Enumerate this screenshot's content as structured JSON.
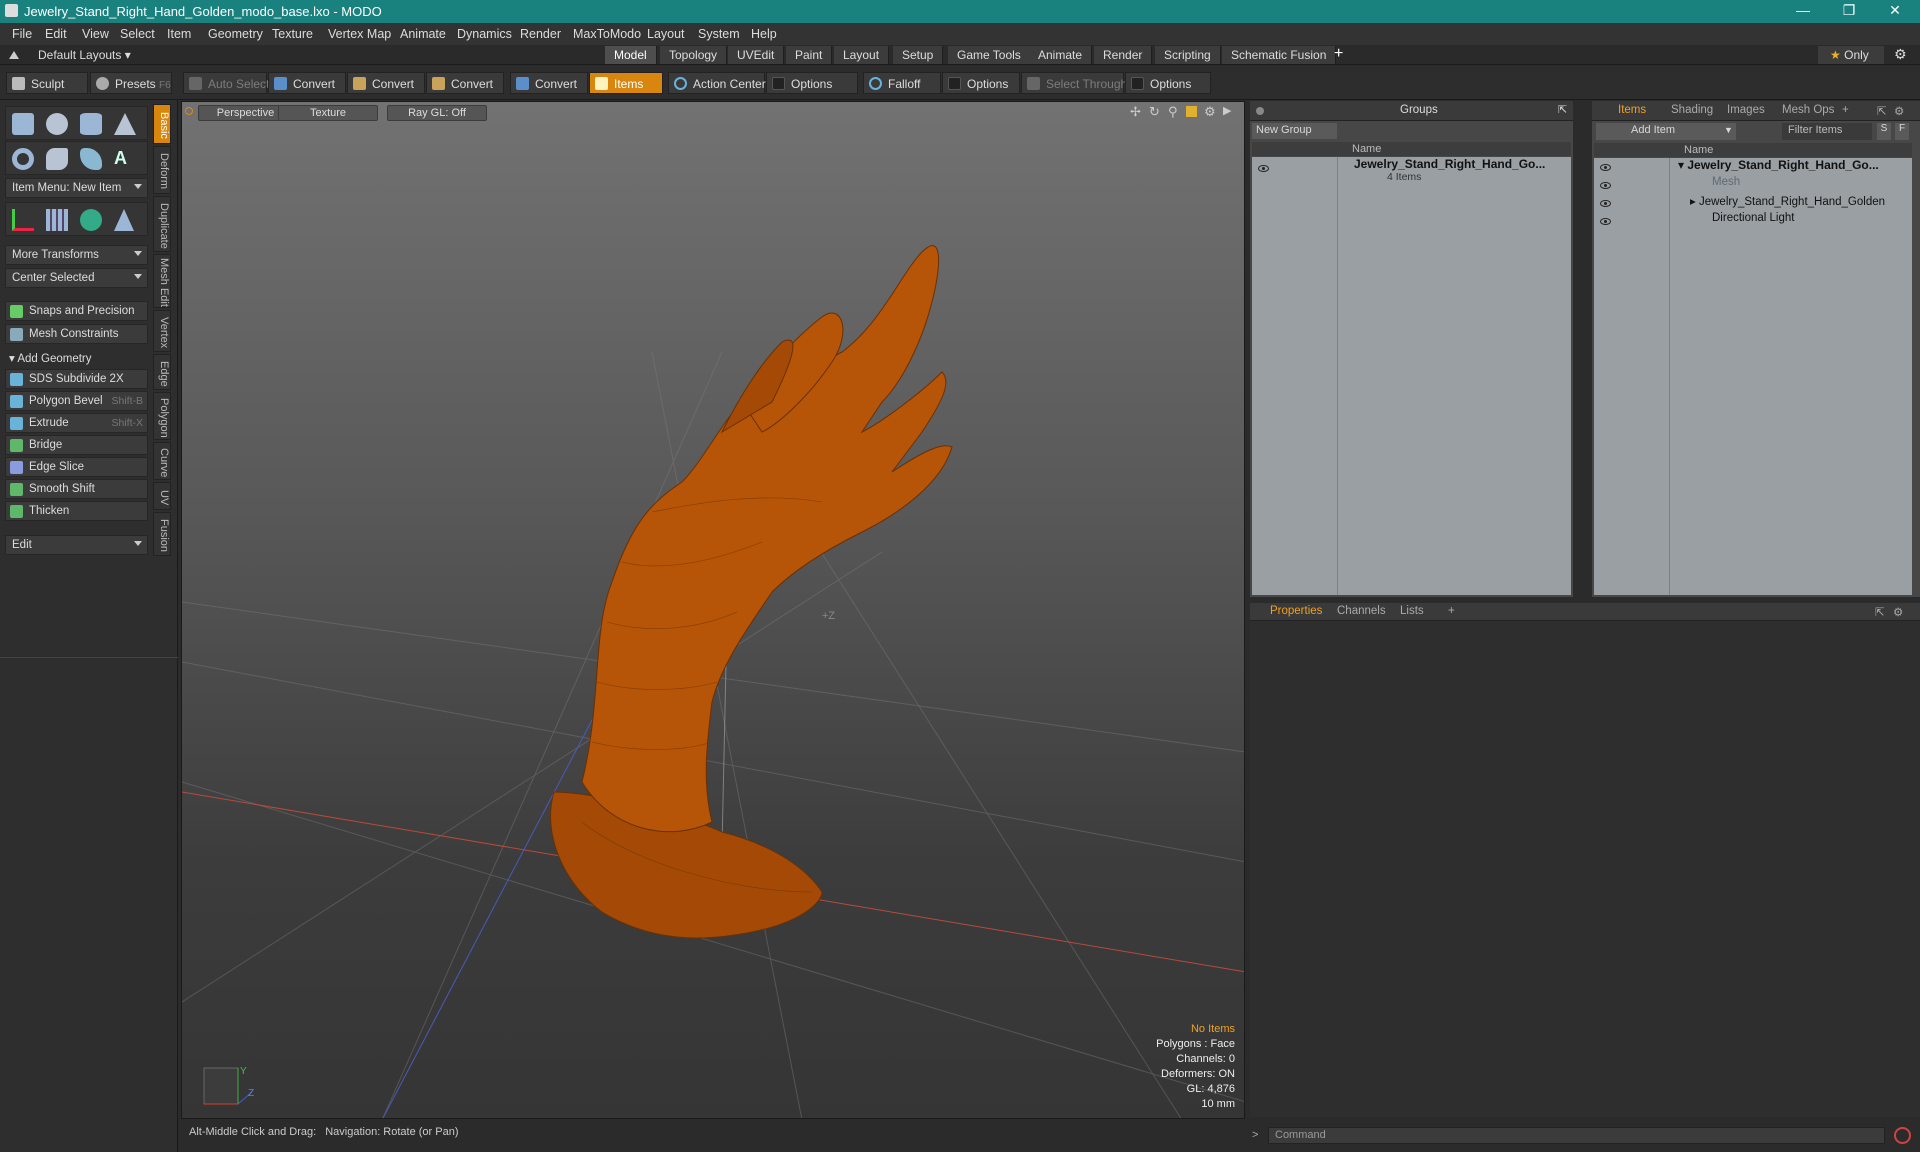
{
  "window": {
    "title": "Jewelry_Stand_Right_Hand_Golden_modo_base.lxo - MODO",
    "min_icon": "minimize-icon",
    "max_icon": "restore-icon",
    "close_icon": "close-icon"
  },
  "menu": [
    "File",
    "Edit",
    "View",
    "Select",
    "Item",
    "Geometry",
    "Texture",
    "Vertex Map",
    "Animate",
    "Dynamics",
    "Render",
    "MaxToModo",
    "Layout",
    "System",
    "Help"
  ],
  "layouts": {
    "selector": "Default Layouts",
    "tabs": [
      "Model",
      "Topology",
      "UVEdit",
      "Paint",
      "Layout",
      "Setup",
      "Game Tools",
      "Animate",
      "Render",
      "Scripting",
      "Schematic Fusion"
    ],
    "active": "Model",
    "add": "+",
    "only": "Only"
  },
  "toolbar": {
    "sculpt": "Sculpt",
    "presets": "Presets",
    "presets_key": "F6",
    "auto_select": "Auto Select",
    "convert": "Convert",
    "items": "Items",
    "action_center": "Action Center",
    "options": "Options",
    "falloff": "Falloff",
    "select_through": "Select Through"
  },
  "left": {
    "item_menu": "Item Menu: New Item",
    "more_transforms": "More Transforms",
    "center_selected": "Center Selected",
    "snaps": "Snaps and Precision",
    "mesh_constraints": "Mesh Constraints",
    "add_geometry": "Add Geometry",
    "tools": [
      {
        "label": "SDS Subdivide 2X",
        "shortcut": ""
      },
      {
        "label": "Polygon Bevel",
        "shortcut": "Shift-B"
      },
      {
        "label": "Extrude",
        "shortcut": "Shift-X"
      },
      {
        "label": "Bridge",
        "shortcut": ""
      },
      {
        "label": "Edge Slice",
        "shortcut": ""
      },
      {
        "label": "Smooth Shift",
        "shortcut": ""
      },
      {
        "label": "Thicken",
        "shortcut": ""
      }
    ],
    "edit": "Edit",
    "vtabs": [
      "Basic",
      "Deform",
      "Duplicate",
      "Mesh Edit",
      "Vertex",
      "Edge",
      "Polygon",
      "Curve",
      "UV",
      "Fusion"
    ]
  },
  "viewport": {
    "view": "Perspective",
    "shading": "Texture",
    "raygl": "Ray GL: Off",
    "axis_label": "+Z",
    "stats": {
      "selection": "No Items",
      "polygons": "Polygons : Face",
      "channels": "Channels: 0",
      "deformers": "Deformers: ON",
      "gl": "GL: 4,876",
      "unit": "10 mm"
    },
    "gizmo": {
      "y": "Y",
      "z": "Z"
    },
    "model_color": "#b65407"
  },
  "status": {
    "hint": "Alt-Middle Click and Drag:",
    "nav": "Navigation: Rotate (or Pan)"
  },
  "groups": {
    "title": "Groups",
    "new_group": "New Group",
    "col_name": "Name",
    "row": "Jewelry_Stand_Right_Hand_Go...",
    "row_count": "4 Items"
  },
  "items_panel": {
    "tabs": [
      "Items",
      "Shading",
      "Images",
      "Mesh Ops"
    ],
    "add_item": "Add Item",
    "filter": "Filter Items",
    "s": "S",
    "f": "F",
    "col_name": "Name",
    "rows": [
      "Jewelry_Stand_Right_Hand_Go...",
      "Mesh",
      "Jewelry_Stand_Right_Hand_Golden",
      "Directional Light"
    ]
  },
  "props": {
    "tabs": [
      "Properties",
      "Channels",
      "Lists"
    ],
    "add": "+"
  },
  "command": {
    "placeholder": "Command"
  }
}
